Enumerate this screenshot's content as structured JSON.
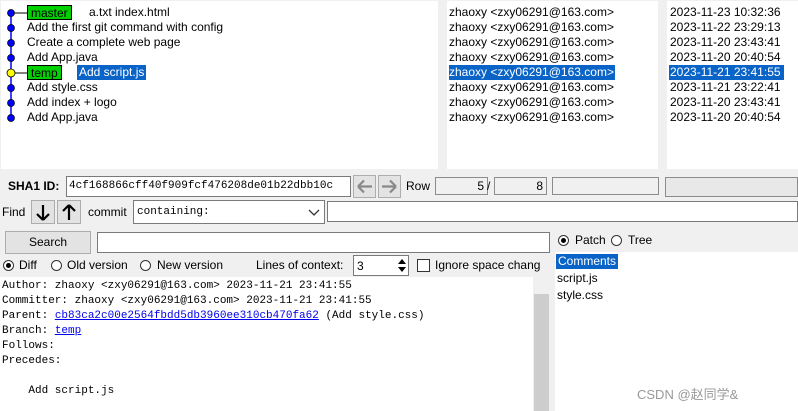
{
  "commits": [
    {
      "subject": "a.txt index.html",
      "ref": "master",
      "author": "zhaoxy <zxy06291@163.com>",
      "date": "2023-11-23 10:32:36"
    },
    {
      "subject": "Add the first git command with config",
      "author": "zhaoxy <zxy06291@163.com>",
      "date": "2023-11-22 23:29:13"
    },
    {
      "subject": "Create a complete web page",
      "author": "zhaoxy <zxy06291@163.com>",
      "date": "2023-11-20 23:43:41"
    },
    {
      "subject": "Add App.java",
      "author": "zhaoxy <zxy06291@163.com>",
      "date": "2023-11-20 20:40:54"
    },
    {
      "subject": "Add script.js",
      "ref": "temp",
      "author": "zhaoxy <zxy06291@163.com>",
      "date": "2023-11-21 23:41:55"
    },
    {
      "subject": "Add style.css",
      "author": "zhaoxy <zxy06291@163.com>",
      "date": "2023-11-21 23:22:41"
    },
    {
      "subject": "Add index + logo",
      "author": "zhaoxy <zxy06291@163.com>",
      "date": "2023-11-20 23:43:41"
    },
    {
      "subject": "Add App.java",
      "author": "zhaoxy <zxy06291@163.com>",
      "date": "2023-11-20 20:40:54"
    }
  ],
  "sha": {
    "label": "SHA1 ID:",
    "value": "4cf168866cff40f909fcf476208de01b22dbb10c",
    "row_label": "Row",
    "row_current": "5",
    "row_sep": "/",
    "row_total": "8"
  },
  "find": {
    "label": "Find",
    "type_label": "commit",
    "mode": "containing:"
  },
  "search": {
    "button": "Search",
    "value": ""
  },
  "diff_opts": {
    "diff": "Diff",
    "old": "Old version",
    "new": "New version",
    "context_label": "Lines of context:",
    "context_value": "3",
    "ignore": "Ignore space chang"
  },
  "details": {
    "author": "Author: zhaoxy <zxy06291@163.com>  2023-11-21 23:41:55",
    "committer": "Committer: zhaoxy <zxy06291@163.com>  2023-11-21 23:41:55",
    "parent_label": "Parent: ",
    "parent_sha": "cb83ca2c00e2564fbdd5db3960ee310cb470fa62",
    "parent_subject": " (Add style.css)",
    "branch_label": "Branch: ",
    "branch": "temp",
    "follows": "Follows:",
    "precedes": "Precedes:",
    "message": "    Add script.js"
  },
  "file_panel": {
    "patch": "Patch",
    "tree": "Tree",
    "items": [
      "Comments",
      "script.js",
      "style.css"
    ]
  },
  "watermark": "CSDN @赵同学&",
  "colors": {
    "selection": "#0a64c8",
    "branch_tag": "#00d000",
    "graph_dot": "#0000ff",
    "graph_current": "#ffff00",
    "link": "#0000ee"
  }
}
